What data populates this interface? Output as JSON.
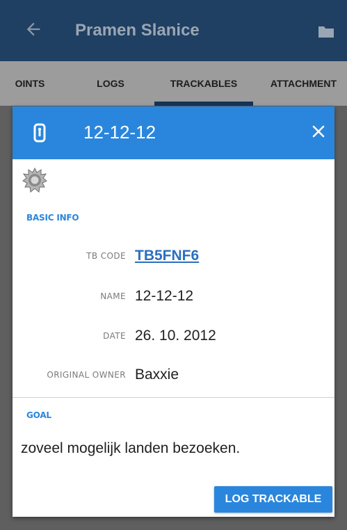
{
  "appbar": {
    "title": "Pramen Slanice",
    "back_icon": "arrow-left-icon",
    "folder_icon": "folder-icon"
  },
  "tabs": [
    {
      "label": "OINTS"
    },
    {
      "label": "LOGS"
    },
    {
      "label": "TRACKABLES"
    },
    {
      "label": "ATTACHMENT"
    }
  ],
  "dialog": {
    "title": "12-12-12",
    "header_icon": "trackable-tag-icon",
    "close_icon": "close-icon",
    "image_icon": "trackable-badge-icon",
    "basic_info_label": "BASIC INFO",
    "fields": [
      {
        "label": "TB CODE",
        "value": "TB5FNF6"
      },
      {
        "label": "NAME",
        "value": "12-12-12"
      },
      {
        "label": "DATE",
        "value": "26. 10. 2012"
      },
      {
        "label": "ORIGINAL OWNER",
        "value": "Baxxie"
      }
    ],
    "goal_label": "GOAL",
    "goal_text": "zoveel mogelijk landen bezoeken.",
    "log_button": "LOG TRACKABLE"
  },
  "colors": {
    "accent": "#2a86dc",
    "appbar": "#1f3f63",
    "tab_indicator": "#173355"
  }
}
